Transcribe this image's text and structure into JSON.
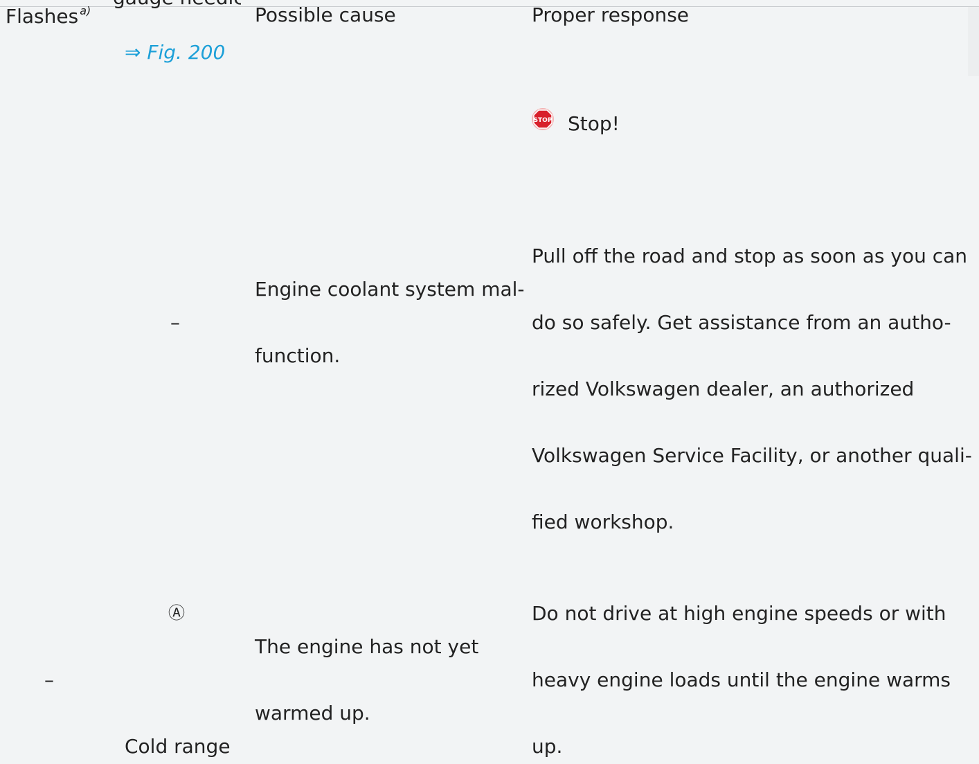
{
  "header": {
    "col_flashes": "Flashes",
    "col_flashes_note": "a)",
    "col_needle_clipped": "gauge needle",
    "col_cause": "Possible cause",
    "col_response": "Proper response"
  },
  "fig_ref": "⇒ Fig. 200",
  "rows": [
    {
      "flashes": "",
      "needle": "–",
      "cause_lines": [
        "Engine coolant system mal-",
        "function."
      ],
      "response_title": "Stop!",
      "response_lines": [
        "Pull off the road and stop as soon as you can",
        "do so safely. Get assistance from an autho-",
        "rized Volkswagen dealer, an authorized",
        "Volkswagen Service Facility, or another quali-",
        "fied workshop."
      ]
    },
    {
      "flashes": "–",
      "needle_marker": "Ⓐ",
      "needle": "Cold range",
      "cause_lines": [
        "The engine has not yet",
        "warmed up."
      ],
      "response_lines": [
        "Do not drive at high engine speeds or with",
        "heavy engine loads until the engine warms",
        "up."
      ]
    }
  ],
  "icons": {
    "stop": "stop-sign-icon"
  },
  "colors": {
    "link": "#1da0d8",
    "stop_red": "#d8202b"
  }
}
